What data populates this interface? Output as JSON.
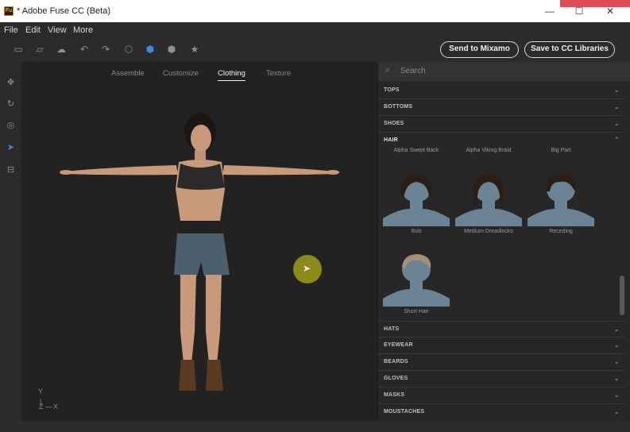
{
  "window": {
    "title": "* Adobe Fuse CC (Beta)",
    "app_badge": "Fu"
  },
  "menu": [
    "File",
    "Edit",
    "View",
    "More"
  ],
  "actions": {
    "send": "Send to Mixamo",
    "save": "Save to CC Libraries"
  },
  "tabs": [
    "Assemble",
    "Customize",
    "Clothing",
    "Texture"
  ],
  "active_tab": "Clothing",
  "axes": {
    "y": "Y",
    "z": "Z",
    "x": "X"
  },
  "search": {
    "placeholder": "Search"
  },
  "categories_top": [
    "TOPS",
    "BOTTOMS",
    "SHOES"
  ],
  "hair": {
    "label": "HAIR",
    "top_row_names": [
      "Alpha Swept Back",
      "Alpha Viking Braid",
      "Big Part"
    ],
    "items": [
      "Bob",
      "Medium Dreadlocks",
      "Receding",
      "Short Hair"
    ]
  },
  "categories_bottom": [
    "HATS",
    "EYEWEAR",
    "BEARDS",
    "GLOVES",
    "MASKS",
    "MOUSTACHES"
  ],
  "colors": {
    "accent": "#e24a56",
    "cursor_highlight": "#8c8a1a",
    "thumb_bg": "#3c4a56",
    "silhouette": "#6a8496"
  }
}
